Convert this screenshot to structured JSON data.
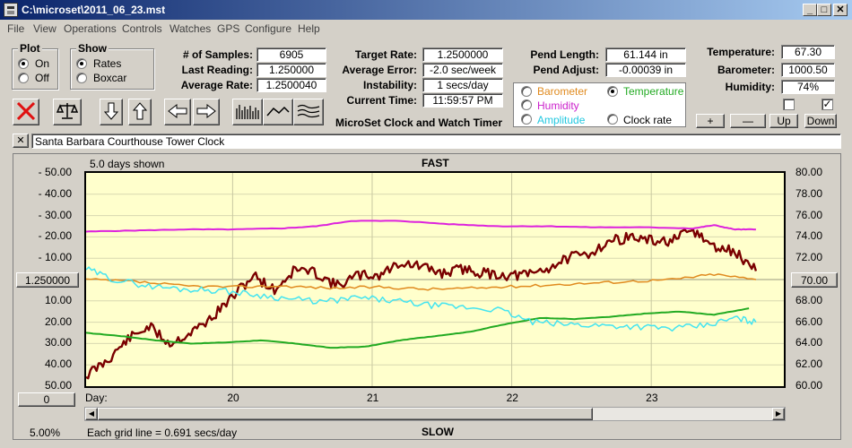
{
  "window": {
    "title": "C:\\microset\\2011_06_23.mst"
  },
  "menu": [
    "File",
    "View",
    "Operations",
    "Controls",
    "Watches",
    "GPS",
    "Configure",
    "Help"
  ],
  "plot_group": {
    "title": "Plot",
    "on_label": "On",
    "off_label": "Off",
    "selected": "On"
  },
  "show_group": {
    "title": "Show",
    "rates_label": "Rates",
    "boxcar_label": "Boxcar",
    "selected": "Rates"
  },
  "stats": {
    "samples_label": "# of Samples:",
    "samples_value": "6905",
    "last_reading_label": "Last Reading:",
    "last_reading_value": "1.250000",
    "avg_rate_label": "Average Rate:",
    "avg_rate_value": "1.2500040",
    "target_rate_label": "Target Rate:",
    "target_rate_value": "1.2500000",
    "avg_error_label": "Average Error:",
    "avg_error_value": "-2.0 sec/week",
    "instability_label": "Instability:",
    "instability_value": "1 secs/day",
    "current_time_label": "Current Time:",
    "current_time_value": "11:59:57 PM",
    "pend_length_label": "Pend Length:",
    "pend_length_value": "61.144 in",
    "pend_adjust_label": "Pend Adjust:",
    "pend_adjust_value": "-0.00039 in",
    "temperature_label": "Temperature:",
    "temperature_value": "67.30",
    "barometer_label": "Barometer:",
    "barometer_value": "1000.50",
    "humidity_label": "Humidity:",
    "humidity_value": "74%"
  },
  "app_label": "MicroSet Clock and Watch Timer",
  "sensor_options": {
    "barometer": "Barometer",
    "temperature": "Temperature",
    "humidity": "Humidity",
    "amplitude": "Amplitude",
    "clock_rate": "Clock rate",
    "selected": "Temperature"
  },
  "axis_buttons": {
    "plus": "+",
    "minus": "—",
    "up": "Up",
    "down": "Down"
  },
  "description": "Santa Barbara Courthouse Tower Clock",
  "description_clear": "✕",
  "colors": {
    "rate": "#7a0000",
    "temperature": "#22aa22",
    "humidity": "#dd22dd",
    "barometer": "#e08a1e",
    "amplitude": "#44e4f0",
    "plot_bg": "#ffffcc"
  },
  "chart": {
    "days_shown": "5.0 days shown",
    "top_label": "FAST",
    "bottom_label": "SLOW",
    "center_left_value": "1.250000",
    "center_right_value": "70.00",
    "offset_value": "0",
    "scale_label": "5.00%",
    "grid_note": "Each grid line = 0.691 secs/day",
    "day_label": "Day:"
  },
  "chart_data": {
    "type": "line",
    "title": "",
    "x_label": "Day",
    "x_ticks": [
      "20",
      "21",
      "22",
      "23"
    ],
    "xlim": [
      18.95,
      23.95
    ],
    "left_axis": {
      "ticks": [
        "- 50.00",
        "- 40.00",
        "- 30.00",
        "- 20.00",
        "- 10.00",
        "1.250000",
        "10.00",
        "20.00",
        "30.00",
        "40.00",
        "50.00"
      ],
      "ylim": [
        -50,
        50
      ]
    },
    "right_axis": {
      "ticks": [
        "80.00",
        "78.00",
        "76.00",
        "74.00",
        "72.00",
        "70.00",
        "68.00",
        "66.00",
        "64.00",
        "62.00",
        "60.00"
      ],
      "ylim": [
        60,
        80
      ]
    },
    "series": [
      {
        "key": "rate",
        "axis": "left",
        "x": [
          18.95,
          19.1,
          19.25,
          19.4,
          19.55,
          19.7,
          19.85,
          20.0,
          20.15,
          20.3,
          20.45,
          20.6,
          20.75,
          20.9,
          21.05,
          21.2,
          21.35,
          21.5,
          21.65,
          21.8,
          21.95,
          22.1,
          22.25,
          22.4,
          22.55,
          22.7,
          22.85,
          23.0,
          23.15,
          23.3,
          23.45,
          23.6,
          23.75
        ],
        "y": [
          45,
          38,
          28,
          22,
          30,
          25,
          18,
          8,
          -2,
          5,
          -5,
          -3,
          3,
          -2,
          -2,
          -8,
          -6,
          -3,
          -5,
          -3,
          -2,
          -2,
          -5,
          -10,
          -12,
          -18,
          -20,
          -18,
          -18,
          -23,
          -15,
          -13,
          -4
        ]
      },
      {
        "key": "temperature",
        "axis": "right",
        "x": [
          18.95,
          19.2,
          19.45,
          19.7,
          19.95,
          20.2,
          20.45,
          20.7,
          20.95,
          21.2,
          21.45,
          21.7,
          21.95,
          22.2,
          22.45,
          22.7,
          22.95,
          23.2,
          23.45,
          23.7
        ],
        "y": [
          65.0,
          64.7,
          64.3,
          64.0,
          64.1,
          64.3,
          64.0,
          63.6,
          63.7,
          64.3,
          64.7,
          65.1,
          65.8,
          66.4,
          66.3,
          66.5,
          66.8,
          67.0,
          66.7,
          67.3
        ]
      },
      {
        "key": "humidity",
        "axis": "right",
        "x": [
          18.95,
          19.3,
          19.65,
          20.0,
          20.35,
          20.6,
          20.85,
          21.2,
          21.55,
          21.9,
          22.25,
          22.6,
          22.95,
          23.3,
          23.45,
          23.6,
          23.75
        ],
        "y": [
          74.5,
          74.6,
          74.7,
          74.7,
          74.8,
          75.0,
          75.5,
          75.5,
          75.2,
          75.0,
          75.0,
          74.9,
          74.9,
          74.8,
          75.1,
          74.7,
          74.7
        ]
      },
      {
        "key": "barometer",
        "axis": "right",
        "x": [
          18.95,
          19.3,
          19.65,
          20.0,
          20.35,
          20.7,
          21.05,
          21.4,
          21.75,
          22.1,
          22.45,
          22.8,
          23.15,
          23.45,
          23.75
        ],
        "y": [
          70.0,
          69.8,
          69.4,
          69.3,
          69.4,
          69.2,
          69.3,
          69.1,
          69.2,
          69.4,
          69.6,
          69.8,
          70.0,
          70.5,
          70.0
        ]
      },
      {
        "key": "amplitude",
        "axis": "right",
        "x": [
          18.95,
          19.15,
          19.4,
          19.65,
          19.9,
          20.15,
          20.4,
          20.65,
          20.9,
          21.15,
          21.4,
          21.65,
          21.9,
          22.15,
          22.4,
          22.65,
          22.9,
          23.15,
          23.4,
          23.6,
          23.75
        ],
        "y": [
          71.0,
          70.0,
          69.4,
          69.1,
          69.0,
          68.6,
          68.2,
          67.9,
          68.3,
          68.0,
          67.6,
          67.4,
          67.2,
          66.0,
          65.8,
          65.7,
          65.6,
          65.4,
          65.7,
          66.4,
          66.0
        ]
      }
    ]
  }
}
